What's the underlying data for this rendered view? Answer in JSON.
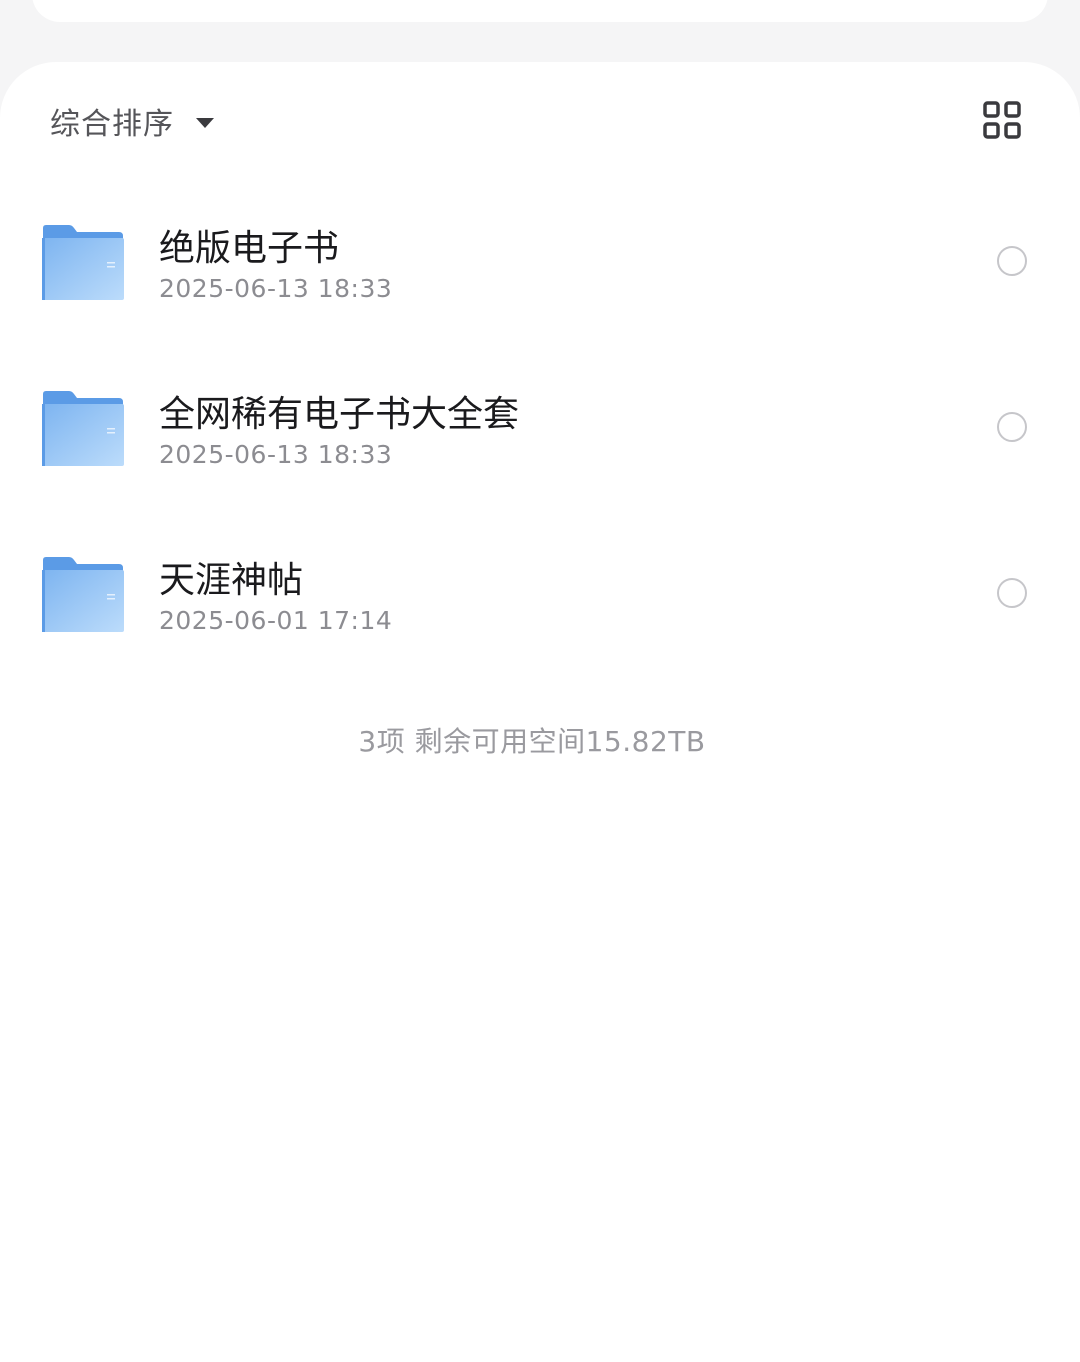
{
  "toolbar": {
    "sort_label": "综合排序",
    "sort_icon": "caret-down-icon",
    "view_toggle_icon": "grid-view-icon"
  },
  "files": [
    {
      "name": "绝版电子书",
      "date": "2025-06-13 18:33",
      "type_icon": "folder-icon",
      "selected": false
    },
    {
      "name": "全网稀有电子书大全套",
      "date": "2025-06-13 18:33",
      "type_icon": "folder-icon",
      "selected": false
    },
    {
      "name": "天涯神帖",
      "date": "2025-06-01 17:14",
      "type_icon": "folder-icon",
      "selected": false
    }
  ],
  "footer": {
    "summary": "3项 剩余可用空间15.82TB"
  },
  "colors": {
    "folder_light": "#b8d8fa",
    "folder_dark": "#6fa8ec",
    "page_background": "#f5f5f6"
  }
}
